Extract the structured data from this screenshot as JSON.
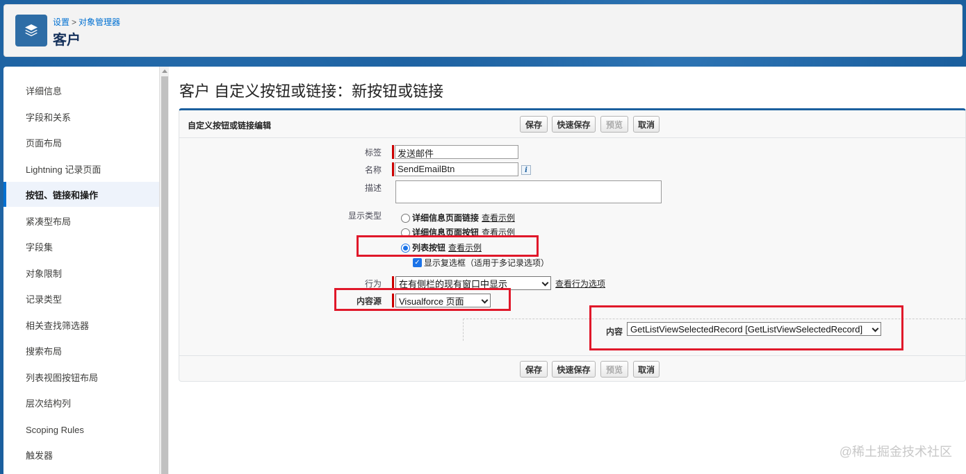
{
  "header": {
    "breadcrumb": [
      "设置",
      "对象管理器"
    ],
    "breadcrumb_sep": ">",
    "title": "客户",
    "icon": "layers-icon"
  },
  "sidebar": {
    "items": [
      {
        "label": "详细信息"
      },
      {
        "label": "字段和关系"
      },
      {
        "label": "页面布局"
      },
      {
        "label": "Lightning 记录页面"
      },
      {
        "label": "按钮、链接和操作",
        "active": true
      },
      {
        "label": "紧凑型布局"
      },
      {
        "label": "字段集"
      },
      {
        "label": "对象限制"
      },
      {
        "label": "记录类型"
      },
      {
        "label": "相关查找筛选器"
      },
      {
        "label": "搜索布局"
      },
      {
        "label": "列表视图按钮布局"
      },
      {
        "label": "层次结构列"
      },
      {
        "label": "Scoping Rules"
      },
      {
        "label": "触发器"
      }
    ]
  },
  "main": {
    "page_title": "客户 自定义按钮或链接：新按钮或链接",
    "panel_title": "自定义按钮或链接编辑",
    "buttons": {
      "save": "保存",
      "quick_save": "快速保存",
      "preview": "预览",
      "cancel": "取消"
    },
    "form": {
      "label_label": "标签",
      "label_value": "发送邮件",
      "name_label": "名称",
      "name_value": "SendEmailBtn",
      "info_icon": "i",
      "description_label": "描述",
      "display_type_label": "显示类型",
      "display_options": [
        {
          "label": "详细信息页面链接",
          "link": "查看示例",
          "selected": false
        },
        {
          "label": "详细信息页面按钮",
          "link": "查看示例",
          "selected": false
        },
        {
          "label": "列表按钮",
          "link": "查看示例",
          "selected": true
        }
      ],
      "checkbox_label": "显示复选框（适用于多记录选项）",
      "checkbox_checked": true,
      "behavior_label": "行为",
      "behavior_value": "在有侧栏的现有窗口中显示",
      "behavior_link": "查看行为选项",
      "content_source_label": "内容源",
      "content_source_value": "Visualforce 页面",
      "content_label": "内容",
      "content_value": "GetListViewSelectedRecord [GetListViewSelectedRecord]"
    },
    "highlight_color": "#e0182a"
  },
  "watermark": "@稀土掘金技术社区"
}
